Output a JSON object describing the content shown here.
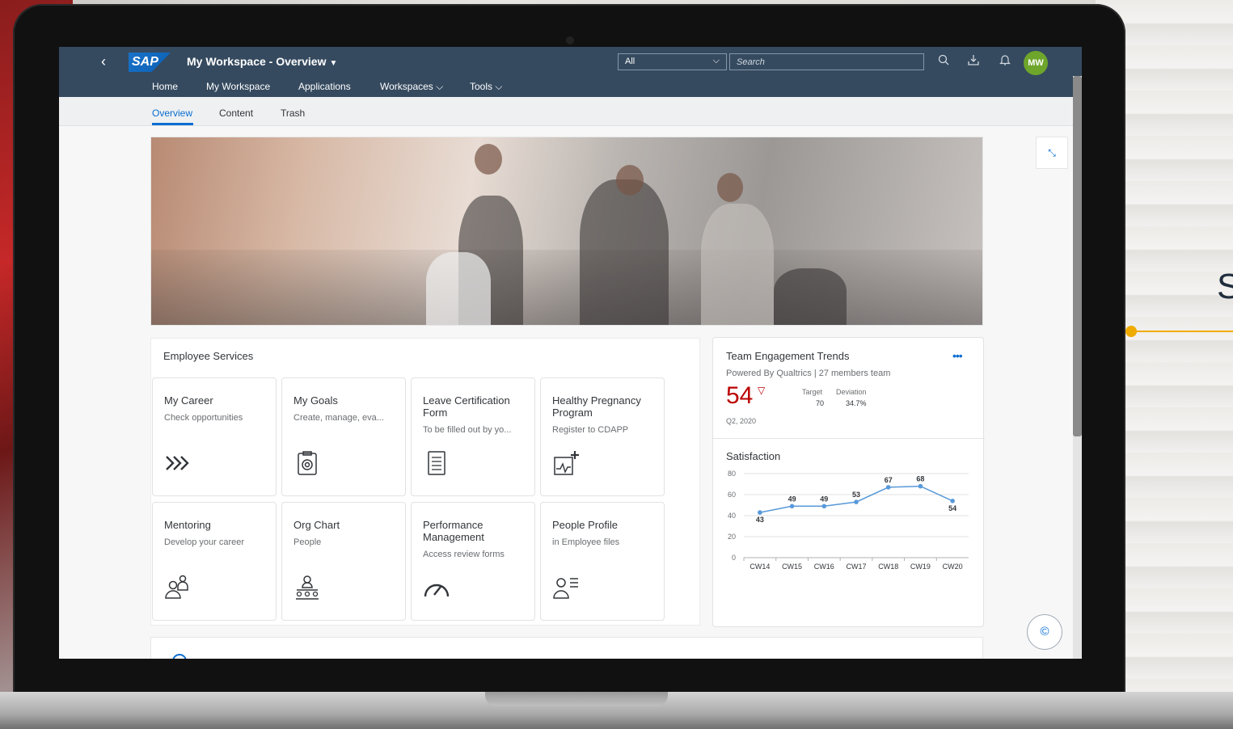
{
  "shell": {
    "back_label": "‹",
    "logo": "SAP",
    "title": "My Workspace - Overview",
    "scope_value": "All",
    "search_placeholder": "Search",
    "user_initials": "MW",
    "nav": [
      "Home",
      "My Workspace",
      "Applications",
      "Workspaces",
      "Tools"
    ],
    "icons": [
      "search-icon",
      "download-icon",
      "bell-icon"
    ],
    "accent": "#354a5f"
  },
  "subtabs": [
    "Overview",
    "Content",
    "Trash"
  ],
  "employee_services": {
    "title": "Employee Services",
    "tiles": [
      {
        "title": "My Career",
        "subtitle": "Check opportunities",
        "icon": "career-arrows-icon"
      },
      {
        "title": "My Goals",
        "subtitle": "Create, manage, eva...",
        "icon": "goals-clipboard-icon"
      },
      {
        "title": "Leave Certification Form",
        "subtitle": "To be filled out by yo...",
        "icon": "form-icon"
      },
      {
        "title": "Healthy Pregnancy Program",
        "subtitle": "Register to CDAPP",
        "icon": "health-chart-icon"
      },
      {
        "title": "Mentoring",
        "subtitle": "Develop your career",
        "icon": "mentoring-icon"
      },
      {
        "title": "Org Chart",
        "subtitle": "People",
        "icon": "org-chart-icon"
      },
      {
        "title": "Performance Management",
        "subtitle": "Access review forms",
        "icon": "gauge-icon"
      },
      {
        "title": "People Profile",
        "subtitle": "in Employee files",
        "icon": "profile-icon"
      }
    ]
  },
  "engagement": {
    "title": "Team Engagement Trends",
    "more": "•••",
    "subtitle": "Powered By Qualtrics | 27 members team",
    "kpi": "54",
    "target_label": "Target",
    "target_value": "70",
    "deviation_label": "Deviation",
    "deviation_value": "34.7%",
    "period": "Q2, 2020",
    "satisfaction_title": "Satisfaction"
  },
  "chart_data": {
    "type": "line",
    "title": "Satisfaction",
    "categories": [
      "CW14",
      "CW15",
      "CW16",
      "CW17",
      "CW18",
      "CW19",
      "CW20"
    ],
    "values": [
      43,
      49,
      49,
      53,
      67,
      68,
      54
    ],
    "ylim": [
      0,
      80
    ],
    "yticks": [
      0,
      20,
      40,
      60,
      80
    ],
    "grid": true,
    "color": "#5899da"
  },
  "side_text": "S"
}
